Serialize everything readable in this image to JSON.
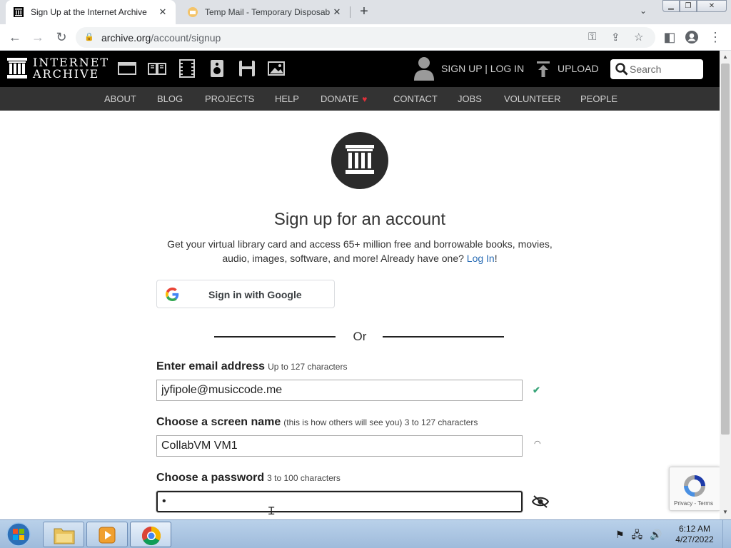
{
  "browser": {
    "tabs": [
      {
        "title": "Sign Up at the Internet Archive",
        "active": true
      },
      {
        "title": "Temp Mail - Temporary Disposab",
        "active": false
      }
    ],
    "url_host": "archive.org",
    "url_path": "/account/signup"
  },
  "ia_header": {
    "logo_line1": "INTERNET",
    "logo_line2": "ARCHIVE",
    "signup_login": "SIGN UP | LOG IN",
    "upload": "UPLOAD",
    "search_placeholder": "Search",
    "nav": [
      "ABOUT",
      "BLOG",
      "PROJECTS",
      "HELP",
      "DONATE",
      "CONTACT",
      "JOBS",
      "VOLUNTEER",
      "PEOPLE"
    ],
    "heart_color": "#e0303a"
  },
  "signup": {
    "title": "Sign up for an account",
    "intro_text": "Get your virtual library card and access 65+ million free and borrowable books, movies, audio, images, software, and more! Already have one?",
    "login_link": "Log In",
    "login_suffix": "!",
    "google_button": "Sign in with Google",
    "or_text": "Or",
    "email_label": "Enter email address",
    "email_hint": "Up to 127 characters",
    "email_value": "jyfipole@musiccode.me",
    "screen_name_label": "Choose a screen name",
    "screen_name_hint": "(this is how others will see you) 3 to 127 characters",
    "screen_name_value": "CollabVM VM1",
    "password_label": "Choose a password",
    "password_hint": "3 to 100 characters",
    "password_value": "•"
  },
  "recaptcha": {
    "terms": "Privacy - Terms"
  },
  "taskbar": {
    "time": "6:12 AM",
    "date": "4/27/2022"
  },
  "colors": {
    "ia_black": "#000000",
    "ia_subnav": "#333333",
    "link_blue": "#2a6db5",
    "check_green": "#3aa57a"
  }
}
